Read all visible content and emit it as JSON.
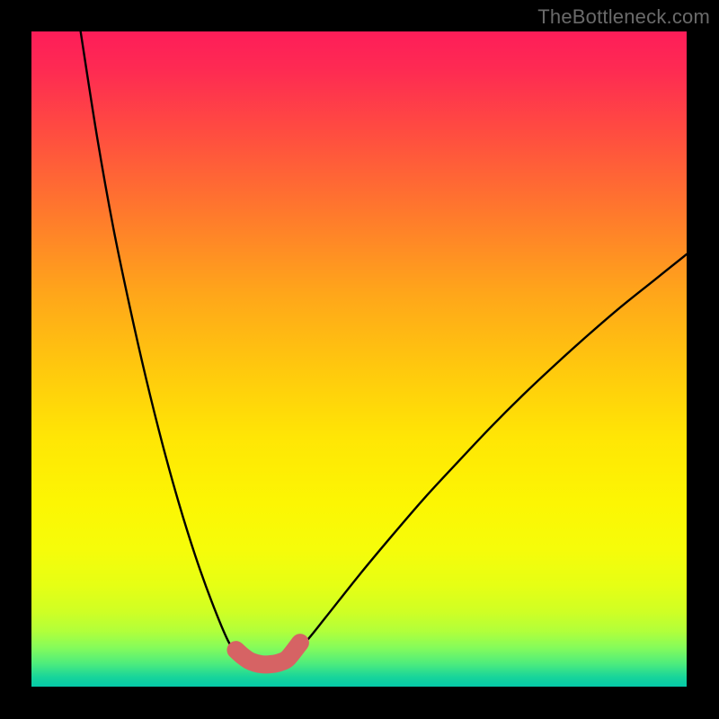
{
  "watermark": "TheBottleneck.com",
  "chart_data": {
    "type": "line",
    "title": "",
    "xlabel": "",
    "ylabel": "",
    "xlim": [
      0,
      1
    ],
    "ylim": [
      0,
      1
    ],
    "notes": "Background encodes a vertical heatmap gradient (red at top through yellow to green at bottom). Two black curves form a V; a salmon-colored marker cluster sits at/near the valley bottom.",
    "series": [
      {
        "name": "left-branch",
        "color": "#000000",
        "x": [
          0.075,
          0.1,
          0.125,
          0.15,
          0.175,
          0.2,
          0.225,
          0.25,
          0.275,
          0.3,
          0.31,
          0.32,
          0.33,
          0.34
        ],
        "y": [
          1.0,
          0.84,
          0.7,
          0.58,
          0.47,
          0.37,
          0.28,
          0.2,
          0.13,
          0.07,
          0.06,
          0.052,
          0.046,
          0.042
        ]
      },
      {
        "name": "right-branch",
        "color": "#000000",
        "x": [
          0.39,
          0.4,
          0.42,
          0.45,
          0.5,
          0.55,
          0.6,
          0.65,
          0.7,
          0.75,
          0.8,
          0.85,
          0.9,
          0.95,
          1.0
        ],
        "y": [
          0.045,
          0.052,
          0.07,
          0.107,
          0.17,
          0.23,
          0.288,
          0.342,
          0.395,
          0.445,
          0.492,
          0.537,
          0.58,
          0.62,
          0.66
        ]
      },
      {
        "name": "valley-markers",
        "color": "#d66364",
        "style": "points-thick",
        "x": [
          0.312,
          0.322,
          0.332,
          0.342,
          0.352,
          0.362,
          0.372,
          0.382,
          0.392,
          0.41
        ],
        "y": [
          0.056,
          0.047,
          0.04,
          0.036,
          0.034,
          0.034,
          0.035,
          0.038,
          0.044,
          0.067
        ]
      }
    ]
  }
}
